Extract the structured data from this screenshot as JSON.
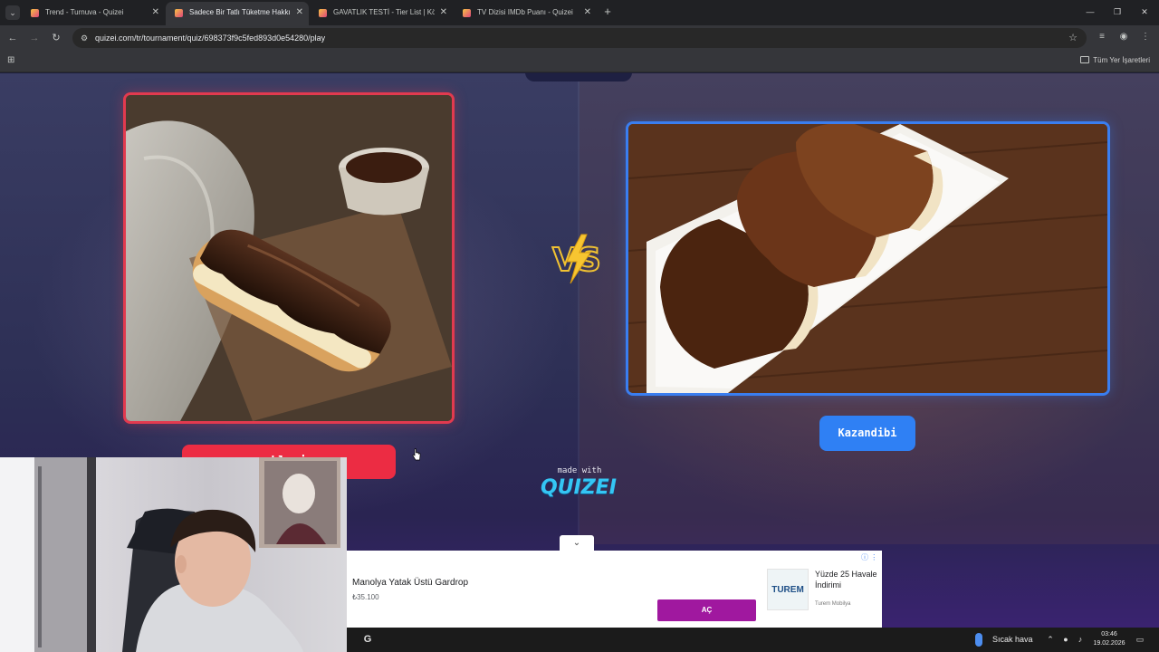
{
  "browser": {
    "tabs": [
      {
        "label": "Trend - Turnuva - Quizei",
        "active": false
      },
      {
        "label": "Sadece Bir Tatlı Tüketme Hakkı",
        "active": true
      },
      {
        "label": "GAVATLIK TESTİ - Tier List | Kör",
        "active": false
      },
      {
        "label": "TV Dizisi IMDb Puanı - Quizei",
        "active": false
      }
    ],
    "url": "quizei.com/tr/tournament/quiz/698373f9c5fed893d0e54280/play",
    "bookmarks_all_label": "Tüm Yer İşaretleri"
  },
  "quiz": {
    "left_option_label": "kleri",
    "right_option_label": "Kazandibi",
    "vs_text": "VS",
    "made_with": "made with",
    "logo_text": "QUIZEI"
  },
  "ad": {
    "title": "Manolya Yatak Üstü Gardrop",
    "price": "₺35.100",
    "button_label": "AÇ",
    "logo_text": "TUREM",
    "promo_text": "Yüzde 25 Havale İndirimi",
    "brand": "Turem Mobilya"
  },
  "taskbar": {
    "weather": "Sıcak hava",
    "time": "03:46",
    "date": "19.02.2026"
  },
  "colors": {
    "left_accent": "#ec2c43",
    "right_accent": "#2f80f4",
    "ad_button": "#a0189f",
    "logo": "#35c6f4"
  }
}
